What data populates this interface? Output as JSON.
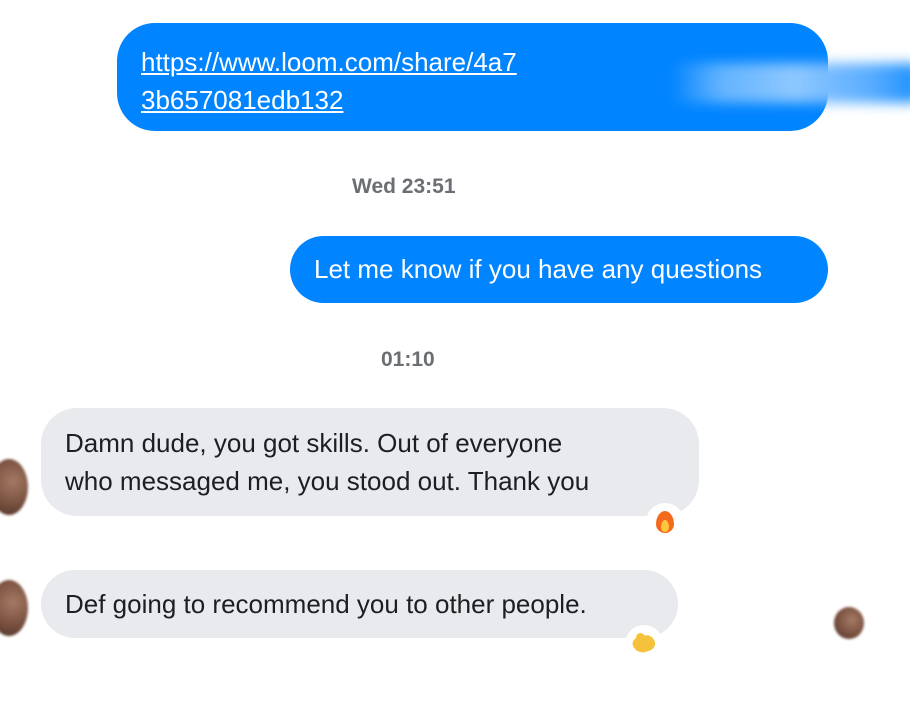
{
  "messages": {
    "link": {
      "visible_text_line1": "https://www.loom.com/share/4a7",
      "visible_text_line2": "3b657081edb132"
    },
    "timestamp_1": "Wed 23:51",
    "question": "Let me know if you have any questions",
    "timestamp_2": "01:10",
    "incoming_1_line1": "Damn dude, you got skills. Out of everyone",
    "incoming_1_line2": "who messaged me, you stood out. Thank you",
    "incoming_2": "Def going to recommend you to other people."
  },
  "reactions": {
    "incoming_1": "fire-icon",
    "incoming_2": "flexed-biceps-icon"
  },
  "colors": {
    "outgoing_bubble": "#0084ff",
    "incoming_bubble": "#e9eaee",
    "timestamp_text": "#6b6e73"
  }
}
